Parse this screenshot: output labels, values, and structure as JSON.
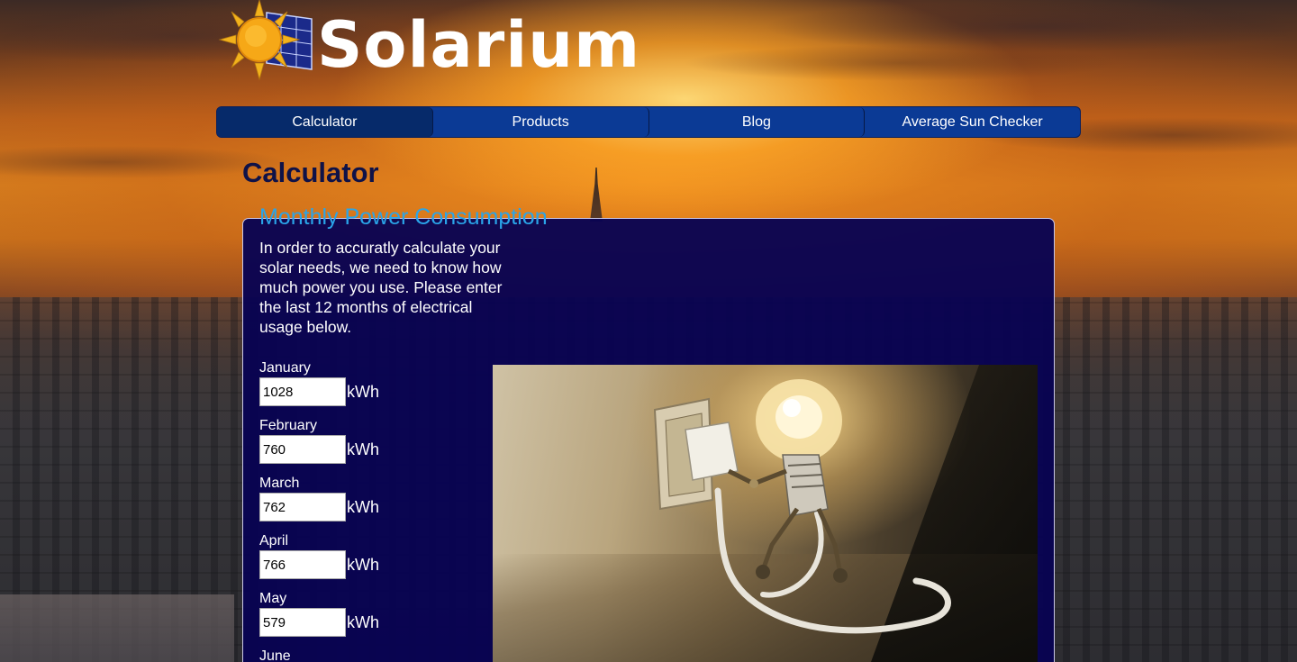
{
  "site": {
    "logo_text": "Solarium"
  },
  "nav": {
    "items": [
      {
        "label": "Calculator",
        "active": true
      },
      {
        "label": "Products",
        "active": false
      },
      {
        "label": "Blog",
        "active": false
      },
      {
        "label": "Average Sun Checker",
        "active": false
      }
    ]
  },
  "page": {
    "title": "Calculator"
  },
  "form": {
    "legend": "Monthly Power Consumption",
    "intro": "In order to accuratly calculate your solar needs, we need to know how much power you use. Please enter the last 12 months of electrical usage below.",
    "unit": "kWh",
    "months": [
      {
        "label": "January",
        "value": "1028"
      },
      {
        "label": "February",
        "value": "760"
      },
      {
        "label": "March",
        "value": "762"
      },
      {
        "label": "April",
        "value": "766"
      },
      {
        "label": "May",
        "value": "579"
      },
      {
        "label": "June",
        "value": ""
      }
    ]
  },
  "colors": {
    "nav_active": "#062a6a",
    "nav_bg": "#0b3a95",
    "panel_bg": "#08035a",
    "legend": "#2aa4e8",
    "title": "#0f1248"
  }
}
